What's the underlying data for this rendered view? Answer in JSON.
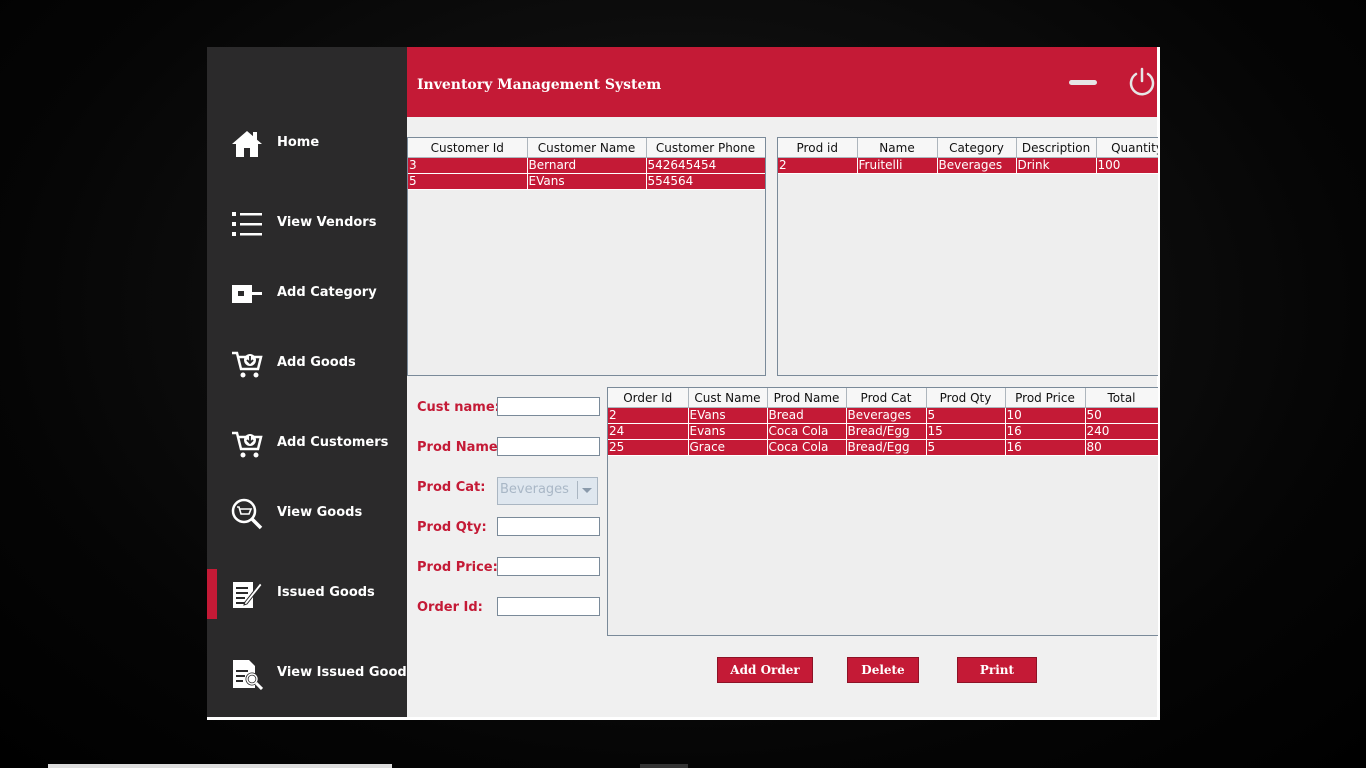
{
  "app": {
    "title": "Inventory Management System"
  },
  "sidebar": {
    "items": [
      {
        "label": "Home",
        "icon": "home-icon"
      },
      {
        "label": "View Vendors",
        "icon": "list-icon"
      },
      {
        "label": "Add Category",
        "icon": "category-icon"
      },
      {
        "label": "Add Goods",
        "icon": "cart-add-icon"
      },
      {
        "label": "Add Customers",
        "icon": "cart-add-icon"
      },
      {
        "label": "View Goods",
        "icon": "cart-search-icon"
      },
      {
        "label": "Issued Goods",
        "icon": "edit-document-icon",
        "active": true
      },
      {
        "label": "View Issued Goods",
        "icon": "document-search-icon"
      }
    ]
  },
  "customers_table": {
    "columns": [
      "Customer Id",
      "Customer Name",
      "Customer Phone"
    ],
    "rows": [
      [
        "3",
        "Bernard",
        "542645454"
      ],
      [
        "5",
        "EVans",
        "554564"
      ]
    ]
  },
  "products_table": {
    "columns": [
      "Prod id",
      "Name",
      "Category",
      "Description",
      "Quantity"
    ],
    "rows": [
      [
        "2",
        "Fruitelli",
        "Beverages",
        "Drink",
        "100"
      ]
    ]
  },
  "orders_table": {
    "columns": [
      "Order Id",
      "Cust Name",
      "Prod Name",
      "Prod Cat",
      "Prod Qty",
      "Prod Price",
      "Total"
    ],
    "rows": [
      [
        "2",
        "EVans",
        "Bread",
        "Beverages",
        "5",
        "10",
        "50"
      ],
      [
        "24",
        "Evans",
        "Coca Cola",
        "Bread/Egg",
        "15",
        "16",
        "240"
      ],
      [
        "25",
        "Grace",
        "Coca Cola",
        "Bread/Egg",
        "5",
        "16",
        "80"
      ]
    ]
  },
  "form": {
    "cust_name_label": "Cust name:",
    "prod_name_label": "Prod Name:",
    "prod_cat_label": "Prod Cat:",
    "prod_cat_value": "Beverages",
    "prod_qty_label": "Prod Qty:",
    "prod_price_label": "Prod Price:",
    "order_id_label": "Order Id:"
  },
  "buttons": {
    "add_order": "Add Order",
    "delete": "Delete",
    "print": "Print"
  },
  "colors": {
    "accent": "#c41a36",
    "sidebar": "#2b2a2b",
    "content_bg": "#f0f0f0"
  }
}
